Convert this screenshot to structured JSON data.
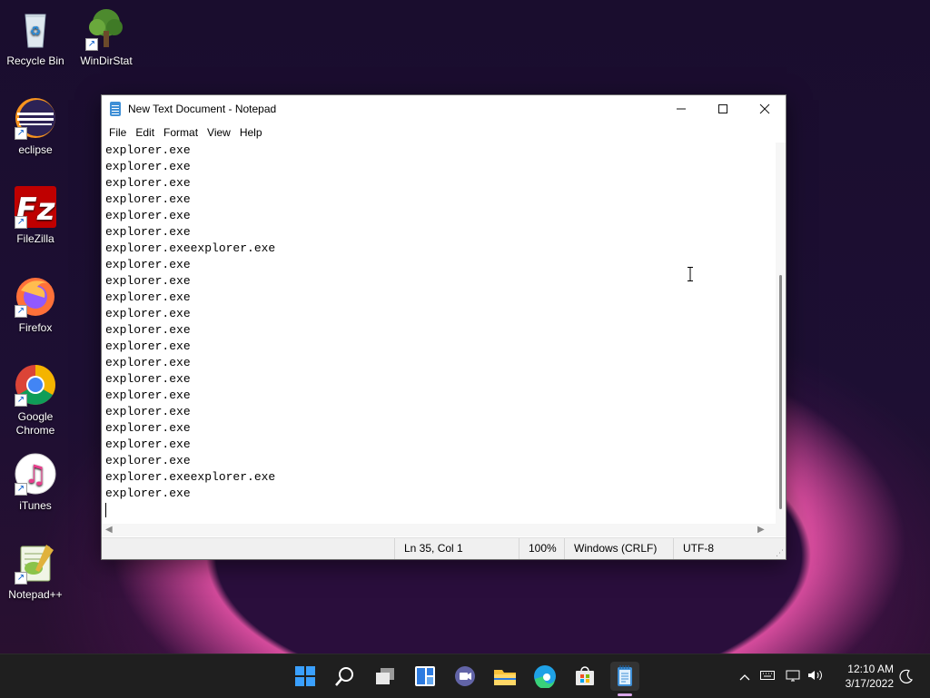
{
  "desktop": {
    "icons": [
      {
        "label": "Recycle Bin"
      },
      {
        "label": "WinDirStat"
      },
      {
        "label": "eclipse"
      },
      {
        "label": "FileZilla"
      },
      {
        "label": "Firefox"
      },
      {
        "label": "Google Chrome"
      },
      {
        "label": "iTunes"
      },
      {
        "label": "Notepad++"
      }
    ]
  },
  "notepad": {
    "title": "New Text Document - Notepad",
    "menu": [
      "File",
      "Edit",
      "Format",
      "View",
      "Help"
    ],
    "lines": [
      "explorer.exe",
      "explorer.exe",
      "explorer.exe",
      "explorer.exe",
      "explorer.exe",
      "explorer.exe",
      "explorer.exeexplorer.exe",
      "explorer.exe",
      "explorer.exe",
      "explorer.exe",
      "explorer.exe",
      "explorer.exe",
      "explorer.exe",
      "explorer.exe",
      "explorer.exe",
      "explorer.exe",
      "explorer.exe",
      "explorer.exe",
      "explorer.exe",
      "explorer.exe",
      "explorer.exeexplorer.exe",
      "explorer.exe"
    ],
    "status": {
      "position": "Ln 35, Col 1",
      "zoom": "100%",
      "line_endings": "Windows (CRLF)",
      "encoding": "UTF-8"
    }
  },
  "taskbar": {
    "apps": [
      "start-icon",
      "search-icon",
      "task-view-icon",
      "widgets-icon",
      "chat-icon",
      "file-explorer-icon",
      "edge-icon",
      "store-icon",
      "notepad-icon"
    ],
    "clock_time": "12:10 AM",
    "clock_date": "3/17/2022"
  }
}
